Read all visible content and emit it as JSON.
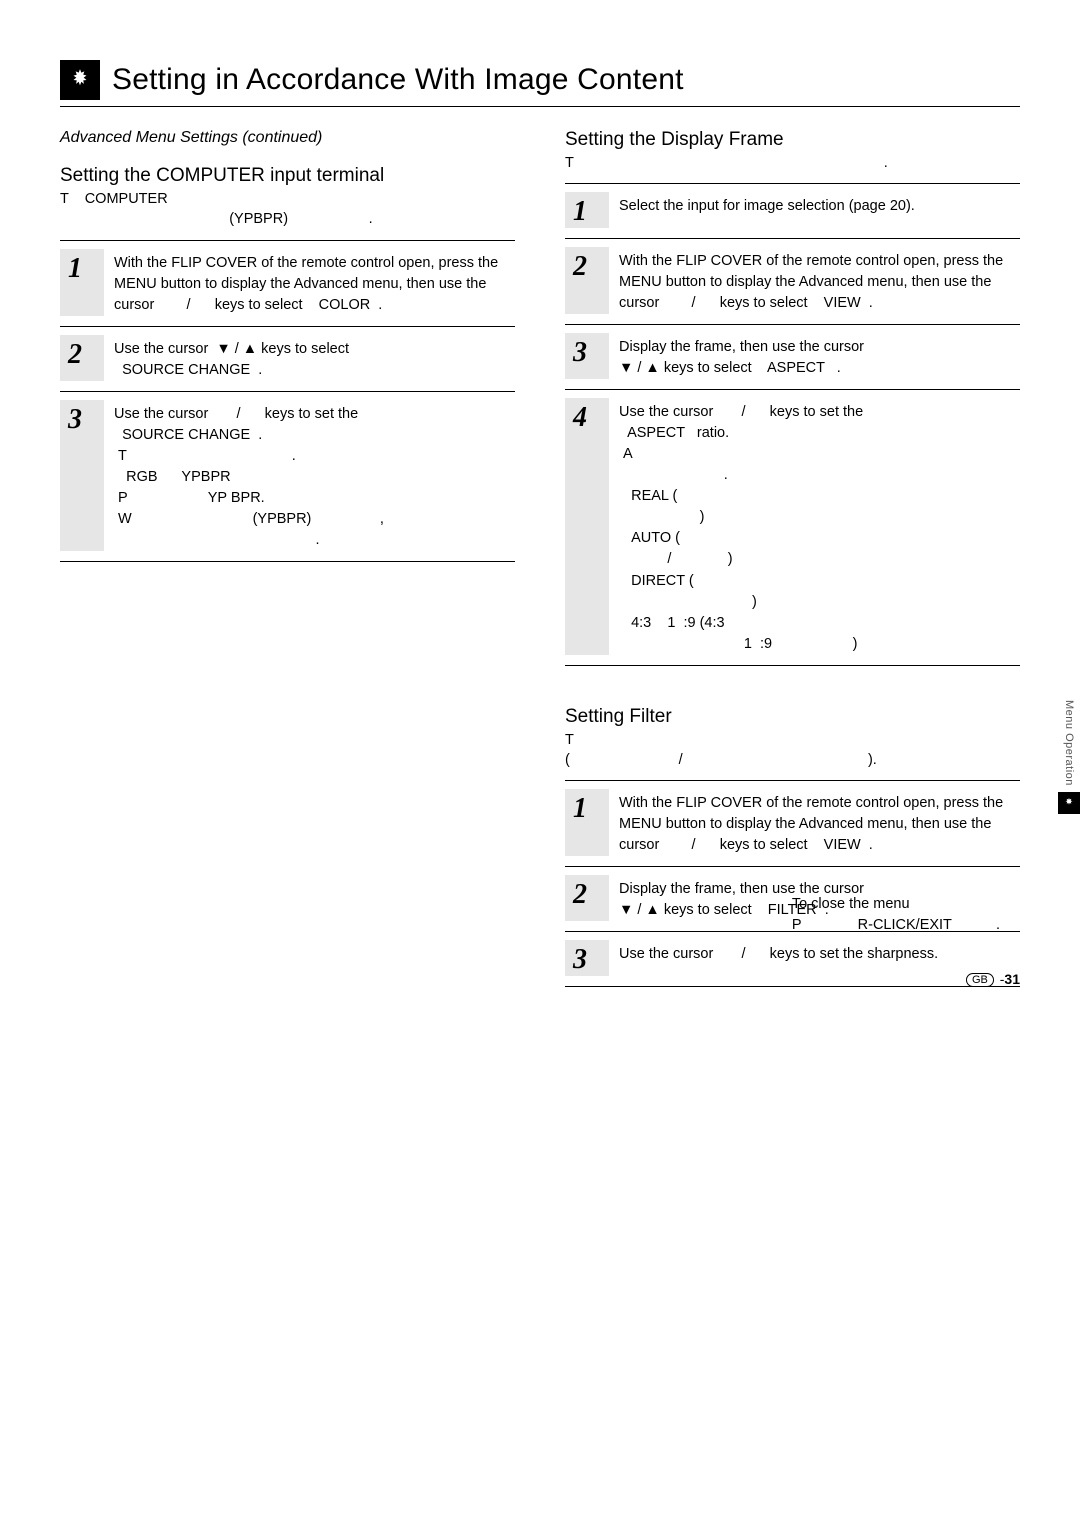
{
  "page_title": "Setting in Accordance With Image Content",
  "continued": "Advanced Menu Settings (continued)",
  "left": {
    "heading": "Setting the COMPUTER input terminal",
    "sub": "T    COMPUTER\n                                          (YPBPR)                    .",
    "steps": [
      {
        "num": "1",
        "body": "With the FLIP COVER of the remote control open, press the MENU button to display the Advanced menu, then use the cursor        /      keys to select    COLOR  ."
      },
      {
        "num": "2",
        "body": "Use the cursor  ▼ / ▲ keys to select\n  SOURCE CHANGE  ."
      },
      {
        "num": "3",
        "body": "Use the cursor       /      keys to set the\n  SOURCE CHANGE  .\n T                                         .\n   RGB      YPBPR\n P                    YP BPR.\n W                              (YPBPR)                 ,\n                                                  ."
      }
    ]
  },
  "right_top": {
    "heading": "Setting the Display Frame",
    "sub": "T                                                                             .",
    "steps": [
      {
        "num": "1",
        "body": "Select the input for image selection (page 20)."
      },
      {
        "num": "2",
        "body": "With the FLIP COVER of the remote control open, press the MENU button to display the Advanced menu, then use the cursor        /      keys to select    VIEW  ."
      },
      {
        "num": "3",
        "body": "Display the frame, then use the cursor\n▼ / ▲ keys to select    ASPECT   ."
      },
      {
        "num": "4",
        "body": "Use the cursor       /      keys to set the\n  ASPECT   ratio.\n A\n                          .\n   REAL (\n                    )\n   AUTO (\n            /              )\n   DIRECT (\n                                 )\n   4:3    1  :9 (4:3\n                               1  :9                    )"
      }
    ]
  },
  "right_bottom": {
    "heading": "Setting Filter",
    "sub": "T\n(                           /                                              ).",
    "steps": [
      {
        "num": "1",
        "body": "With the FLIP COVER of the remote control open, press the MENU button to display the Advanced menu, then use the cursor        /      keys to select    VIEW  ."
      },
      {
        "num": "2",
        "body": "Display the frame, then use the cursor\n▼ / ▲ keys to select    FILTER  ."
      },
      {
        "num": "3",
        "body": "Use the cursor       /      keys to set the sharpness."
      }
    ]
  },
  "side_label": "Menu Operation",
  "footer_close": "To close the menu\nP              R-CLICK/EXIT           .",
  "page_num_region": "GB",
  "page_num_dash": "-",
  "page_num": "31"
}
